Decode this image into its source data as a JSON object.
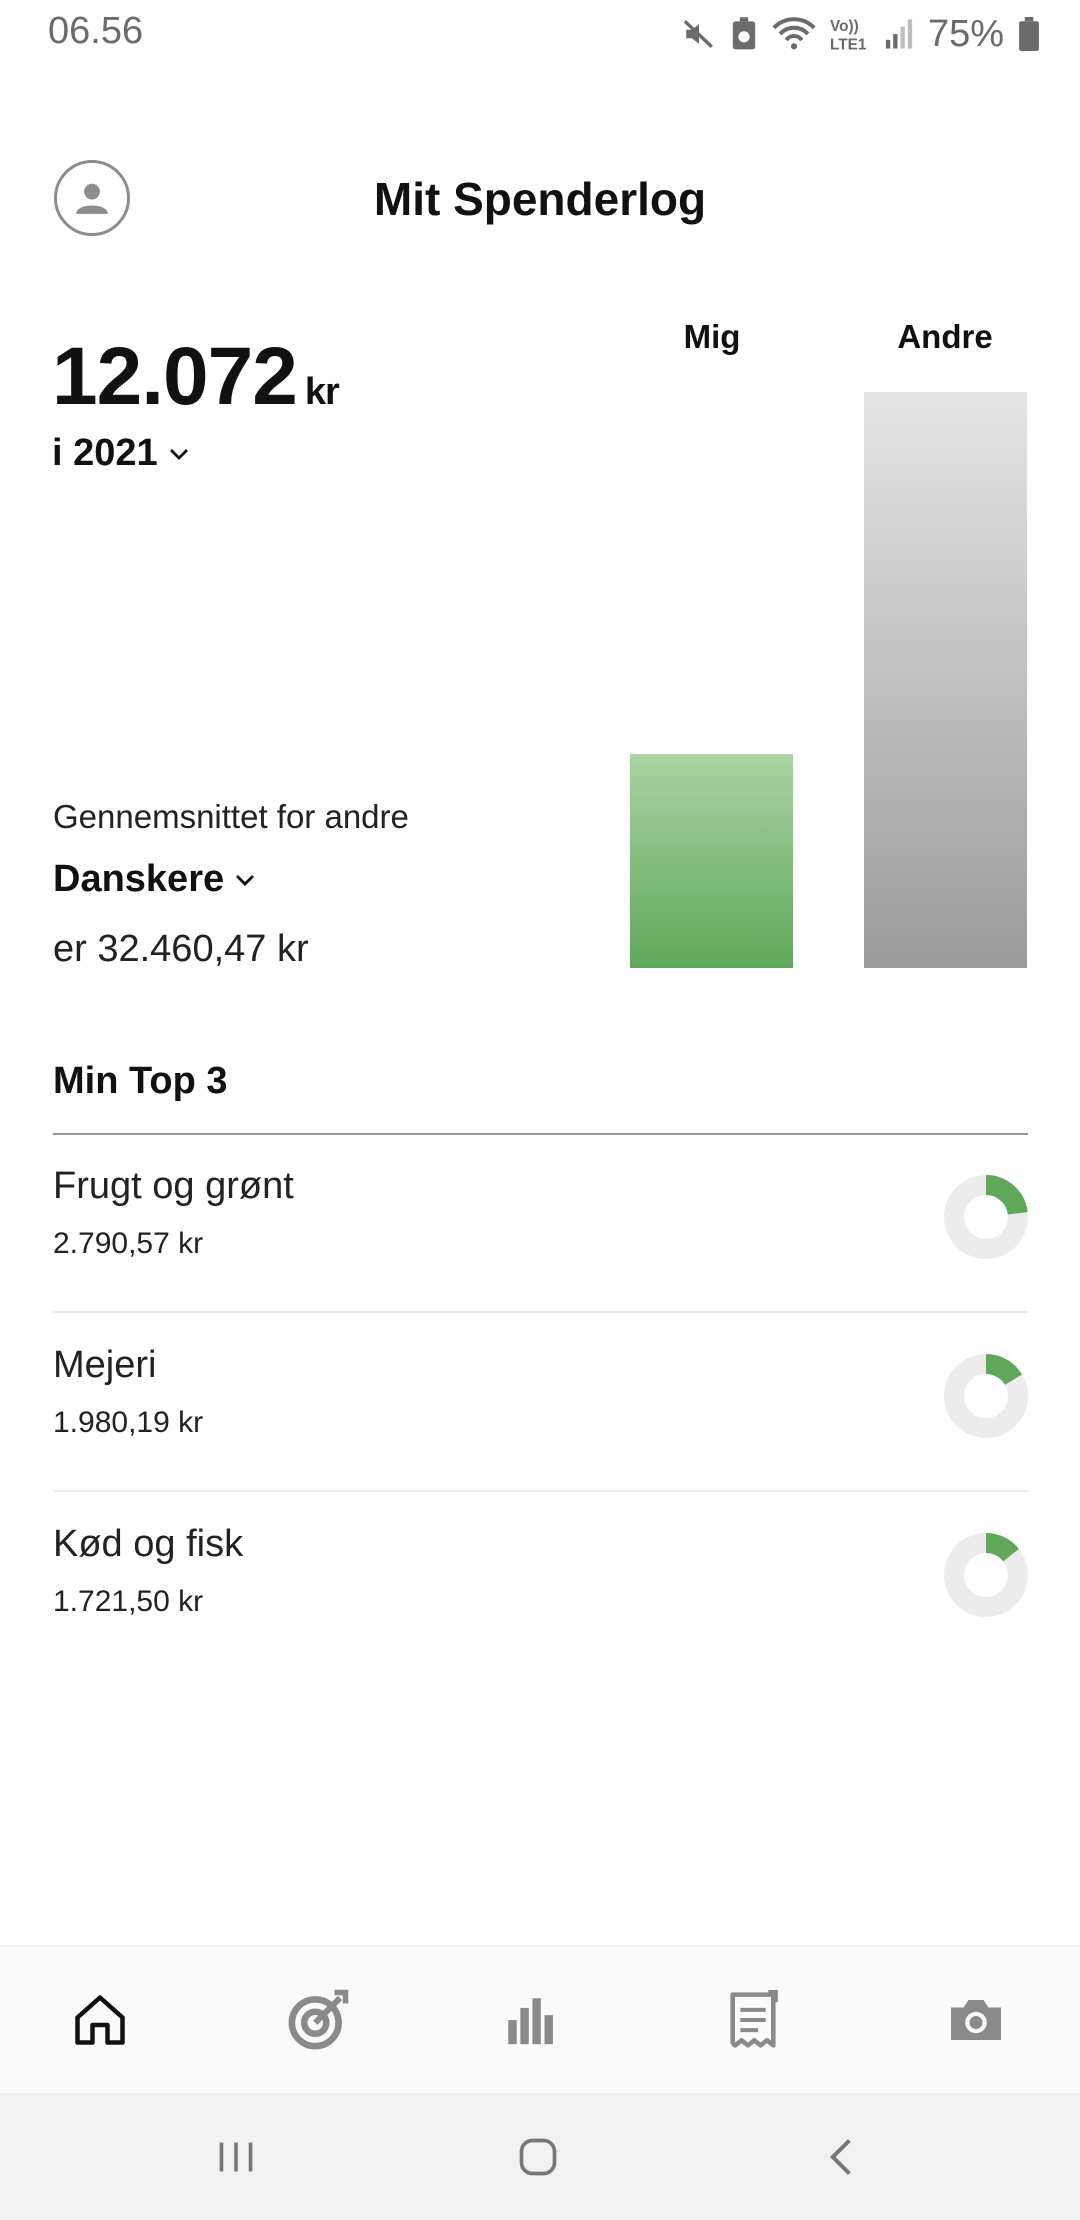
{
  "status_bar": {
    "time": "06.56",
    "battery": "75%",
    "icons": [
      "mute-icon",
      "battery-saver-icon",
      "wifi-icon",
      "volte-lte-icon",
      "signal-icon",
      "battery-icon"
    ]
  },
  "header": {
    "title": "Mit Spenderlog",
    "profile_icon": "profile-icon"
  },
  "summary": {
    "total_amount": "12.072",
    "total_unit": "kr",
    "year_label": "i 2021",
    "avg_intro": "Gennemsnittet for andre",
    "group_label": "Danskere",
    "avg_value": "er 32.460,47 kr"
  },
  "chart_data": {
    "type": "bar",
    "categories": [
      "Mig",
      "Andre"
    ],
    "values": [
      12072,
      32460.47
    ],
    "ylim": [
      0,
      32460.47
    ],
    "colors": [
      "#6aac62",
      "#9e9e9e"
    ]
  },
  "top3": {
    "heading": "Min Top 3",
    "items": [
      {
        "name": "Frugt og grønt",
        "amount": "2.790,57 kr",
        "share": 0.231
      },
      {
        "name": "Mejeri",
        "amount": "1.980,19 kr",
        "share": 0.164
      },
      {
        "name": "Kød og fisk",
        "amount": "1.721,50 kr",
        "share": 0.143
      }
    ]
  },
  "bottom_nav": {
    "items": [
      "home-icon",
      "goal-target-icon",
      "bar-chart-icon",
      "receipt-icon",
      "camera-icon"
    ]
  },
  "system_nav": {
    "items": [
      "recent-apps-icon",
      "home-button-icon",
      "back-icon"
    ]
  },
  "colors": {
    "accent_green": "#5fa85a",
    "donut_track": "#ececec",
    "icon_gray": "#888888"
  }
}
